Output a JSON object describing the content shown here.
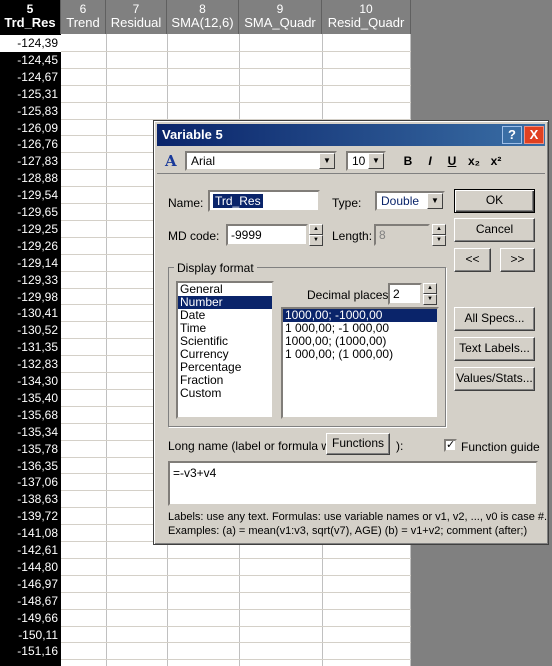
{
  "spreadsheet": {
    "columns": [
      {
        "num": "5",
        "name": "Trd_Res"
      },
      {
        "num": "6",
        "name": "Trend"
      },
      {
        "num": "7",
        "name": "Residual"
      },
      {
        "num": "8",
        "name": "SMA(12,6)"
      },
      {
        "num": "9",
        "name": "SMA_Quadr"
      },
      {
        "num": "10",
        "name": "Resid_Quadr"
      }
    ],
    "values": [
      "-124,39",
      "-124,45",
      "-124,67",
      "-125,31",
      "-125,83",
      "-126,09",
      "-126,76",
      "-127,83",
      "-128,88",
      "-129,54",
      "-129,65",
      "-129,25",
      "-129,26",
      "-129,14",
      "-129,33",
      "-129,98",
      "-130,41",
      "-130,52",
      "-131,35",
      "-132,83",
      "-134,30",
      "-135,40",
      "-135,68",
      "-135,34",
      "-135,78",
      "-136,35",
      "-137,06",
      "-138,63",
      "-139,72",
      "-141,08",
      "-142,61",
      "-144,80",
      "-146,97",
      "-148,67",
      "-149,66",
      "-150,11",
      "-151,16"
    ]
  },
  "dialog": {
    "title": "Variable 5",
    "help_label": "?",
    "close_label": "X",
    "font": {
      "name": "Arial",
      "size": "10",
      "bold": "B",
      "italic": "I",
      "underline": "U",
      "sub": "x₂",
      "sup": "x²",
      "icon": "A"
    },
    "name_label": "Name:",
    "name_value": "Trd_Res",
    "type_label": "Type:",
    "type_value": "Double",
    "md_label": "MD code:",
    "md_value": "-9999",
    "length_label": "Length:",
    "length_value": "8",
    "ok_label": "OK",
    "cancel_label": "Cancel",
    "prev_label": "<<",
    "next_label": ">>",
    "display_format_label": "Display format",
    "formats": [
      "General",
      "Number",
      "Date",
      "Time",
      "Scientific",
      "Currency",
      "Percentage",
      "Fraction",
      "Custom"
    ],
    "selected_format": "Number",
    "decimal_label": "Decimal places:",
    "decimal_value": "2",
    "number_formats": [
      "1000,00; -1000,00",
      "1 000,00; -1 000,00",
      "1000,00; (1000,00)",
      "1 000,00; (1 000,00)"
    ],
    "selected_number_format": "1000,00; -1000,00",
    "all_specs_label": "All Specs...",
    "text_labels_label": "Text Labels...",
    "values_stats_label": "Values/Stats...",
    "long_name_label": "Long name (label or formula with",
    "functions_label": "Functions",
    "long_name_close": "):",
    "function_guide_label": "Function guide",
    "function_guide_checked": true,
    "formula": "=-v3+v4",
    "help_line1": "Labels: use any text.  Formulas: use variable names or v1, v2, ..., v0 is case #.",
    "help_line2": "Examples:   (a) = mean(v1:v3, sqrt(v7), AGE)   (b) = v1+v2; comment (after;)"
  }
}
